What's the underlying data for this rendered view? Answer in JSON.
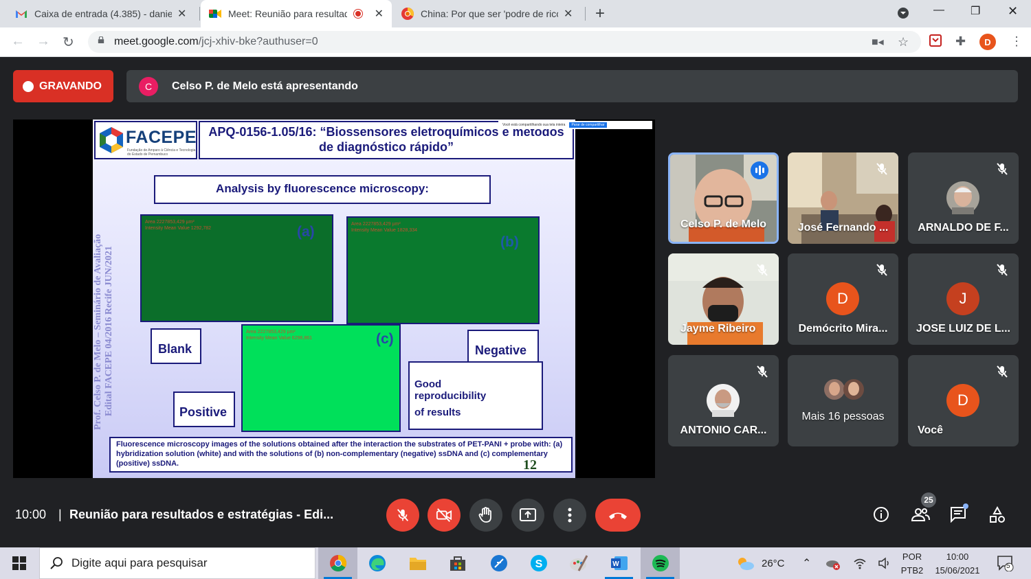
{
  "browser": {
    "tabs": [
      {
        "label": "Caixa de entrada (4.385) - daniel.",
        "icon": "gmail-icon"
      },
      {
        "label": "Meet: Reunião para resultado",
        "icon": "meet-icon",
        "recording": true
      },
      {
        "label": "China: Por que ser 'podre de rico",
        "icon": "chrome-icon"
      }
    ],
    "url_main": "meet.google.com",
    "url_rest": "/jcj-xhiv-bke?authuser=0",
    "profile_initial": "D"
  },
  "meet": {
    "recording_label": "GRAVANDO",
    "presenter_initial": "C",
    "presenter_text": "Celso P. de Melo está apresentando",
    "share_banner": "Você está compartilhando sua tela inteira",
    "share_stop": "Parar de compartilhar",
    "slide": {
      "org": "FACEPE",
      "org_sub": "Fundação de Amparo à Ciência e Tecnologia do Estado de Pernambuco",
      "title": "APQ-0156-1.05/16: “Biossensores eletroquímicos e métodos de diagnóstico rápido”",
      "heading": "Analysis by fluorescence microscopy:",
      "side_line1": "Prof. Celso P. de Melo – Seminário de Avaliação",
      "side_line2": "Edital FACEPE 04/2016   Recife JUN/2021",
      "panels": [
        {
          "label": "(a)",
          "meta1": "Area 2227853,429 µm²",
          "meta2": "Intensity Mean Value 1292,782"
        },
        {
          "label": "(b)",
          "meta1": "Area 2227853,429 µm²",
          "meta2": "Intensity Mean Value 1828,334"
        },
        {
          "label": "(c)",
          "meta1": "Area 2227853,429 µm²",
          "meta2": "Intensity Mean Value 6296,861"
        }
      ],
      "blank": "Blank",
      "negative": "Negative",
      "positive": "Positive",
      "good1": "Good",
      "good2": "reproducibility",
      "good3": "of results",
      "caption": "Fluorescence microscopy images of the solutions obtained after the interaction the substrates of PET-PANI + probe with: (a) hybridization solution (white) and with the solutions of (b) non-complementary (negative) ssDNA and (c) complementary (positive) ssDNA.",
      "page": "12",
      "colors": {
        "panel_a": "#0b6e2a",
        "panel_b": "#0a7a2e",
        "panel_c": "#00e05a"
      }
    },
    "participants": [
      {
        "name": "Celso P. de Melo",
        "type": "video",
        "speaking": true
      },
      {
        "name": "José Fernando ...",
        "type": "video",
        "muted": true
      },
      {
        "name": "ARNALDO DE F...",
        "type": "photo",
        "muted": true
      },
      {
        "name": "Jayme Ribeiro",
        "type": "video",
        "muted": true
      },
      {
        "name": "Demócrito Mira...",
        "type": "initial",
        "initial": "D",
        "color": "#e8541c",
        "muted": true
      },
      {
        "name": "JOSE LUIZ DE L...",
        "type": "initial",
        "initial": "J",
        "color": "#c5401f",
        "muted": true
      },
      {
        "name": "ANTONIO CAR...",
        "type": "photo",
        "muted": true
      },
      {
        "name": "Mais 16 pessoas",
        "type": "group"
      },
      {
        "name": "Você",
        "type": "initial",
        "initial": "D",
        "color": "#e8541c",
        "muted": true
      }
    ],
    "time": "10:00",
    "separator": "|",
    "meeting_title": "Reunião para resultados e estratégias - Edi...",
    "people_count": "25"
  },
  "taskbar": {
    "search_placeholder": "Digite aqui para pesquisar",
    "weather": "26°C",
    "lang1": "POR",
    "lang2": "PTB2",
    "time": "10:00",
    "date": "15/06/2021",
    "notifications": "5"
  }
}
